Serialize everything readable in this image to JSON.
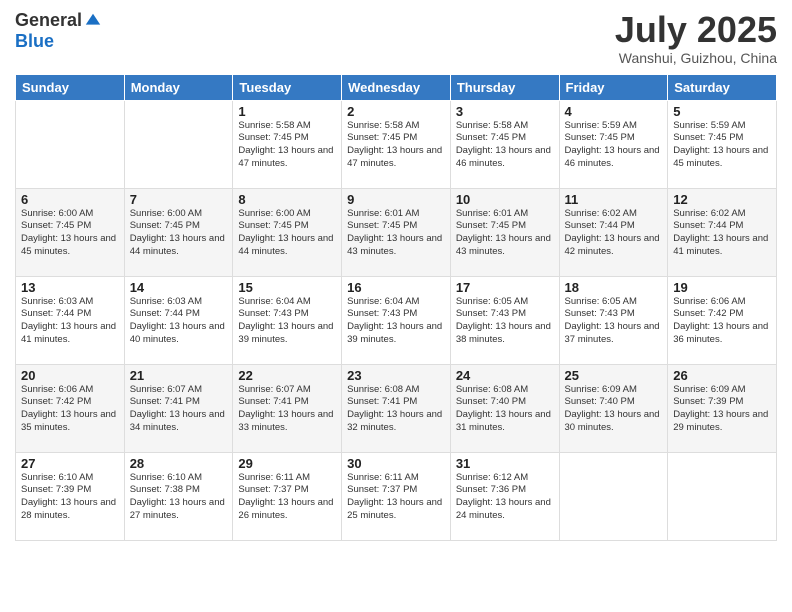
{
  "header": {
    "logo_general": "General",
    "logo_blue": "Blue",
    "title": "July 2025",
    "subtitle": "Wanshui, Guizhou, China"
  },
  "weekdays": [
    "Sunday",
    "Monday",
    "Tuesday",
    "Wednesday",
    "Thursday",
    "Friday",
    "Saturday"
  ],
  "weeks": [
    [
      {
        "day": "",
        "info": ""
      },
      {
        "day": "",
        "info": ""
      },
      {
        "day": "1",
        "info": "Sunrise: 5:58 AM\nSunset: 7:45 PM\nDaylight: 13 hours and 47 minutes."
      },
      {
        "day": "2",
        "info": "Sunrise: 5:58 AM\nSunset: 7:45 PM\nDaylight: 13 hours and 47 minutes."
      },
      {
        "day": "3",
        "info": "Sunrise: 5:58 AM\nSunset: 7:45 PM\nDaylight: 13 hours and 46 minutes."
      },
      {
        "day": "4",
        "info": "Sunrise: 5:59 AM\nSunset: 7:45 PM\nDaylight: 13 hours and 46 minutes."
      },
      {
        "day": "5",
        "info": "Sunrise: 5:59 AM\nSunset: 7:45 PM\nDaylight: 13 hours and 45 minutes."
      }
    ],
    [
      {
        "day": "6",
        "info": "Sunrise: 6:00 AM\nSunset: 7:45 PM\nDaylight: 13 hours and 45 minutes."
      },
      {
        "day": "7",
        "info": "Sunrise: 6:00 AM\nSunset: 7:45 PM\nDaylight: 13 hours and 44 minutes."
      },
      {
        "day": "8",
        "info": "Sunrise: 6:00 AM\nSunset: 7:45 PM\nDaylight: 13 hours and 44 minutes."
      },
      {
        "day": "9",
        "info": "Sunrise: 6:01 AM\nSunset: 7:45 PM\nDaylight: 13 hours and 43 minutes."
      },
      {
        "day": "10",
        "info": "Sunrise: 6:01 AM\nSunset: 7:45 PM\nDaylight: 13 hours and 43 minutes."
      },
      {
        "day": "11",
        "info": "Sunrise: 6:02 AM\nSunset: 7:44 PM\nDaylight: 13 hours and 42 minutes."
      },
      {
        "day": "12",
        "info": "Sunrise: 6:02 AM\nSunset: 7:44 PM\nDaylight: 13 hours and 41 minutes."
      }
    ],
    [
      {
        "day": "13",
        "info": "Sunrise: 6:03 AM\nSunset: 7:44 PM\nDaylight: 13 hours and 41 minutes."
      },
      {
        "day": "14",
        "info": "Sunrise: 6:03 AM\nSunset: 7:44 PM\nDaylight: 13 hours and 40 minutes."
      },
      {
        "day": "15",
        "info": "Sunrise: 6:04 AM\nSunset: 7:43 PM\nDaylight: 13 hours and 39 minutes."
      },
      {
        "day": "16",
        "info": "Sunrise: 6:04 AM\nSunset: 7:43 PM\nDaylight: 13 hours and 39 minutes."
      },
      {
        "day": "17",
        "info": "Sunrise: 6:05 AM\nSunset: 7:43 PM\nDaylight: 13 hours and 38 minutes."
      },
      {
        "day": "18",
        "info": "Sunrise: 6:05 AM\nSunset: 7:43 PM\nDaylight: 13 hours and 37 minutes."
      },
      {
        "day": "19",
        "info": "Sunrise: 6:06 AM\nSunset: 7:42 PM\nDaylight: 13 hours and 36 minutes."
      }
    ],
    [
      {
        "day": "20",
        "info": "Sunrise: 6:06 AM\nSunset: 7:42 PM\nDaylight: 13 hours and 35 minutes."
      },
      {
        "day": "21",
        "info": "Sunrise: 6:07 AM\nSunset: 7:41 PM\nDaylight: 13 hours and 34 minutes."
      },
      {
        "day": "22",
        "info": "Sunrise: 6:07 AM\nSunset: 7:41 PM\nDaylight: 13 hours and 33 minutes."
      },
      {
        "day": "23",
        "info": "Sunrise: 6:08 AM\nSunset: 7:41 PM\nDaylight: 13 hours and 32 minutes."
      },
      {
        "day": "24",
        "info": "Sunrise: 6:08 AM\nSunset: 7:40 PM\nDaylight: 13 hours and 31 minutes."
      },
      {
        "day": "25",
        "info": "Sunrise: 6:09 AM\nSunset: 7:40 PM\nDaylight: 13 hours and 30 minutes."
      },
      {
        "day": "26",
        "info": "Sunrise: 6:09 AM\nSunset: 7:39 PM\nDaylight: 13 hours and 29 minutes."
      }
    ],
    [
      {
        "day": "27",
        "info": "Sunrise: 6:10 AM\nSunset: 7:39 PM\nDaylight: 13 hours and 28 minutes."
      },
      {
        "day": "28",
        "info": "Sunrise: 6:10 AM\nSunset: 7:38 PM\nDaylight: 13 hours and 27 minutes."
      },
      {
        "day": "29",
        "info": "Sunrise: 6:11 AM\nSunset: 7:37 PM\nDaylight: 13 hours and 26 minutes."
      },
      {
        "day": "30",
        "info": "Sunrise: 6:11 AM\nSunset: 7:37 PM\nDaylight: 13 hours and 25 minutes."
      },
      {
        "day": "31",
        "info": "Sunrise: 6:12 AM\nSunset: 7:36 PM\nDaylight: 13 hours and 24 minutes."
      },
      {
        "day": "",
        "info": ""
      },
      {
        "day": "",
        "info": ""
      }
    ]
  ]
}
